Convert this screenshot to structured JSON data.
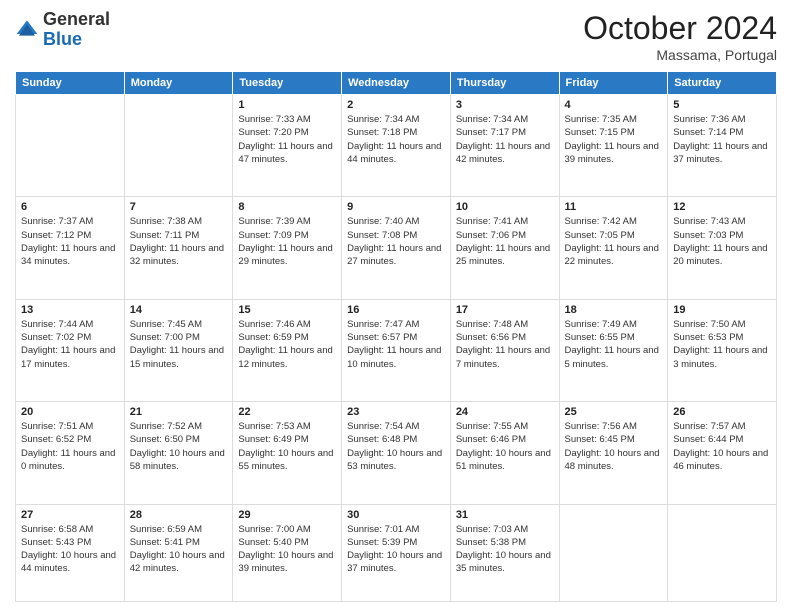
{
  "logo": {
    "general": "General",
    "blue": "Blue"
  },
  "header": {
    "month": "October 2024",
    "location": "Massama, Portugal"
  },
  "days_of_week": [
    "Sunday",
    "Monday",
    "Tuesday",
    "Wednesday",
    "Thursday",
    "Friday",
    "Saturday"
  ],
  "weeks": [
    [
      {
        "day": "",
        "sunrise": "",
        "sunset": "",
        "daylight": ""
      },
      {
        "day": "",
        "sunrise": "",
        "sunset": "",
        "daylight": ""
      },
      {
        "day": "1",
        "sunrise": "Sunrise: 7:33 AM",
        "sunset": "Sunset: 7:20 PM",
        "daylight": "Daylight: 11 hours and 47 minutes."
      },
      {
        "day": "2",
        "sunrise": "Sunrise: 7:34 AM",
        "sunset": "Sunset: 7:18 PM",
        "daylight": "Daylight: 11 hours and 44 minutes."
      },
      {
        "day": "3",
        "sunrise": "Sunrise: 7:34 AM",
        "sunset": "Sunset: 7:17 PM",
        "daylight": "Daylight: 11 hours and 42 minutes."
      },
      {
        "day": "4",
        "sunrise": "Sunrise: 7:35 AM",
        "sunset": "Sunset: 7:15 PM",
        "daylight": "Daylight: 11 hours and 39 minutes."
      },
      {
        "day": "5",
        "sunrise": "Sunrise: 7:36 AM",
        "sunset": "Sunset: 7:14 PM",
        "daylight": "Daylight: 11 hours and 37 minutes."
      }
    ],
    [
      {
        "day": "6",
        "sunrise": "Sunrise: 7:37 AM",
        "sunset": "Sunset: 7:12 PM",
        "daylight": "Daylight: 11 hours and 34 minutes."
      },
      {
        "day": "7",
        "sunrise": "Sunrise: 7:38 AM",
        "sunset": "Sunset: 7:11 PM",
        "daylight": "Daylight: 11 hours and 32 minutes."
      },
      {
        "day": "8",
        "sunrise": "Sunrise: 7:39 AM",
        "sunset": "Sunset: 7:09 PM",
        "daylight": "Daylight: 11 hours and 29 minutes."
      },
      {
        "day": "9",
        "sunrise": "Sunrise: 7:40 AM",
        "sunset": "Sunset: 7:08 PM",
        "daylight": "Daylight: 11 hours and 27 minutes."
      },
      {
        "day": "10",
        "sunrise": "Sunrise: 7:41 AM",
        "sunset": "Sunset: 7:06 PM",
        "daylight": "Daylight: 11 hours and 25 minutes."
      },
      {
        "day": "11",
        "sunrise": "Sunrise: 7:42 AM",
        "sunset": "Sunset: 7:05 PM",
        "daylight": "Daylight: 11 hours and 22 minutes."
      },
      {
        "day": "12",
        "sunrise": "Sunrise: 7:43 AM",
        "sunset": "Sunset: 7:03 PM",
        "daylight": "Daylight: 11 hours and 20 minutes."
      }
    ],
    [
      {
        "day": "13",
        "sunrise": "Sunrise: 7:44 AM",
        "sunset": "Sunset: 7:02 PM",
        "daylight": "Daylight: 11 hours and 17 minutes."
      },
      {
        "day": "14",
        "sunrise": "Sunrise: 7:45 AM",
        "sunset": "Sunset: 7:00 PM",
        "daylight": "Daylight: 11 hours and 15 minutes."
      },
      {
        "day": "15",
        "sunrise": "Sunrise: 7:46 AM",
        "sunset": "Sunset: 6:59 PM",
        "daylight": "Daylight: 11 hours and 12 minutes."
      },
      {
        "day": "16",
        "sunrise": "Sunrise: 7:47 AM",
        "sunset": "Sunset: 6:57 PM",
        "daylight": "Daylight: 11 hours and 10 minutes."
      },
      {
        "day": "17",
        "sunrise": "Sunrise: 7:48 AM",
        "sunset": "Sunset: 6:56 PM",
        "daylight": "Daylight: 11 hours and 7 minutes."
      },
      {
        "day": "18",
        "sunrise": "Sunrise: 7:49 AM",
        "sunset": "Sunset: 6:55 PM",
        "daylight": "Daylight: 11 hours and 5 minutes."
      },
      {
        "day": "19",
        "sunrise": "Sunrise: 7:50 AM",
        "sunset": "Sunset: 6:53 PM",
        "daylight": "Daylight: 11 hours and 3 minutes."
      }
    ],
    [
      {
        "day": "20",
        "sunrise": "Sunrise: 7:51 AM",
        "sunset": "Sunset: 6:52 PM",
        "daylight": "Daylight: 11 hours and 0 minutes."
      },
      {
        "day": "21",
        "sunrise": "Sunrise: 7:52 AM",
        "sunset": "Sunset: 6:50 PM",
        "daylight": "Daylight: 10 hours and 58 minutes."
      },
      {
        "day": "22",
        "sunrise": "Sunrise: 7:53 AM",
        "sunset": "Sunset: 6:49 PM",
        "daylight": "Daylight: 10 hours and 55 minutes."
      },
      {
        "day": "23",
        "sunrise": "Sunrise: 7:54 AM",
        "sunset": "Sunset: 6:48 PM",
        "daylight": "Daylight: 10 hours and 53 minutes."
      },
      {
        "day": "24",
        "sunrise": "Sunrise: 7:55 AM",
        "sunset": "Sunset: 6:46 PM",
        "daylight": "Daylight: 10 hours and 51 minutes."
      },
      {
        "day": "25",
        "sunrise": "Sunrise: 7:56 AM",
        "sunset": "Sunset: 6:45 PM",
        "daylight": "Daylight: 10 hours and 48 minutes."
      },
      {
        "day": "26",
        "sunrise": "Sunrise: 7:57 AM",
        "sunset": "Sunset: 6:44 PM",
        "daylight": "Daylight: 10 hours and 46 minutes."
      }
    ],
    [
      {
        "day": "27",
        "sunrise": "Sunrise: 6:58 AM",
        "sunset": "Sunset: 5:43 PM",
        "daylight": "Daylight: 10 hours and 44 minutes."
      },
      {
        "day": "28",
        "sunrise": "Sunrise: 6:59 AM",
        "sunset": "Sunset: 5:41 PM",
        "daylight": "Daylight: 10 hours and 42 minutes."
      },
      {
        "day": "29",
        "sunrise": "Sunrise: 7:00 AM",
        "sunset": "Sunset: 5:40 PM",
        "daylight": "Daylight: 10 hours and 39 minutes."
      },
      {
        "day": "30",
        "sunrise": "Sunrise: 7:01 AM",
        "sunset": "Sunset: 5:39 PM",
        "daylight": "Daylight: 10 hours and 37 minutes."
      },
      {
        "day": "31",
        "sunrise": "Sunrise: 7:03 AM",
        "sunset": "Sunset: 5:38 PM",
        "daylight": "Daylight: 10 hours and 35 minutes."
      },
      {
        "day": "",
        "sunrise": "",
        "sunset": "",
        "daylight": ""
      },
      {
        "day": "",
        "sunrise": "",
        "sunset": "",
        "daylight": ""
      }
    ]
  ]
}
